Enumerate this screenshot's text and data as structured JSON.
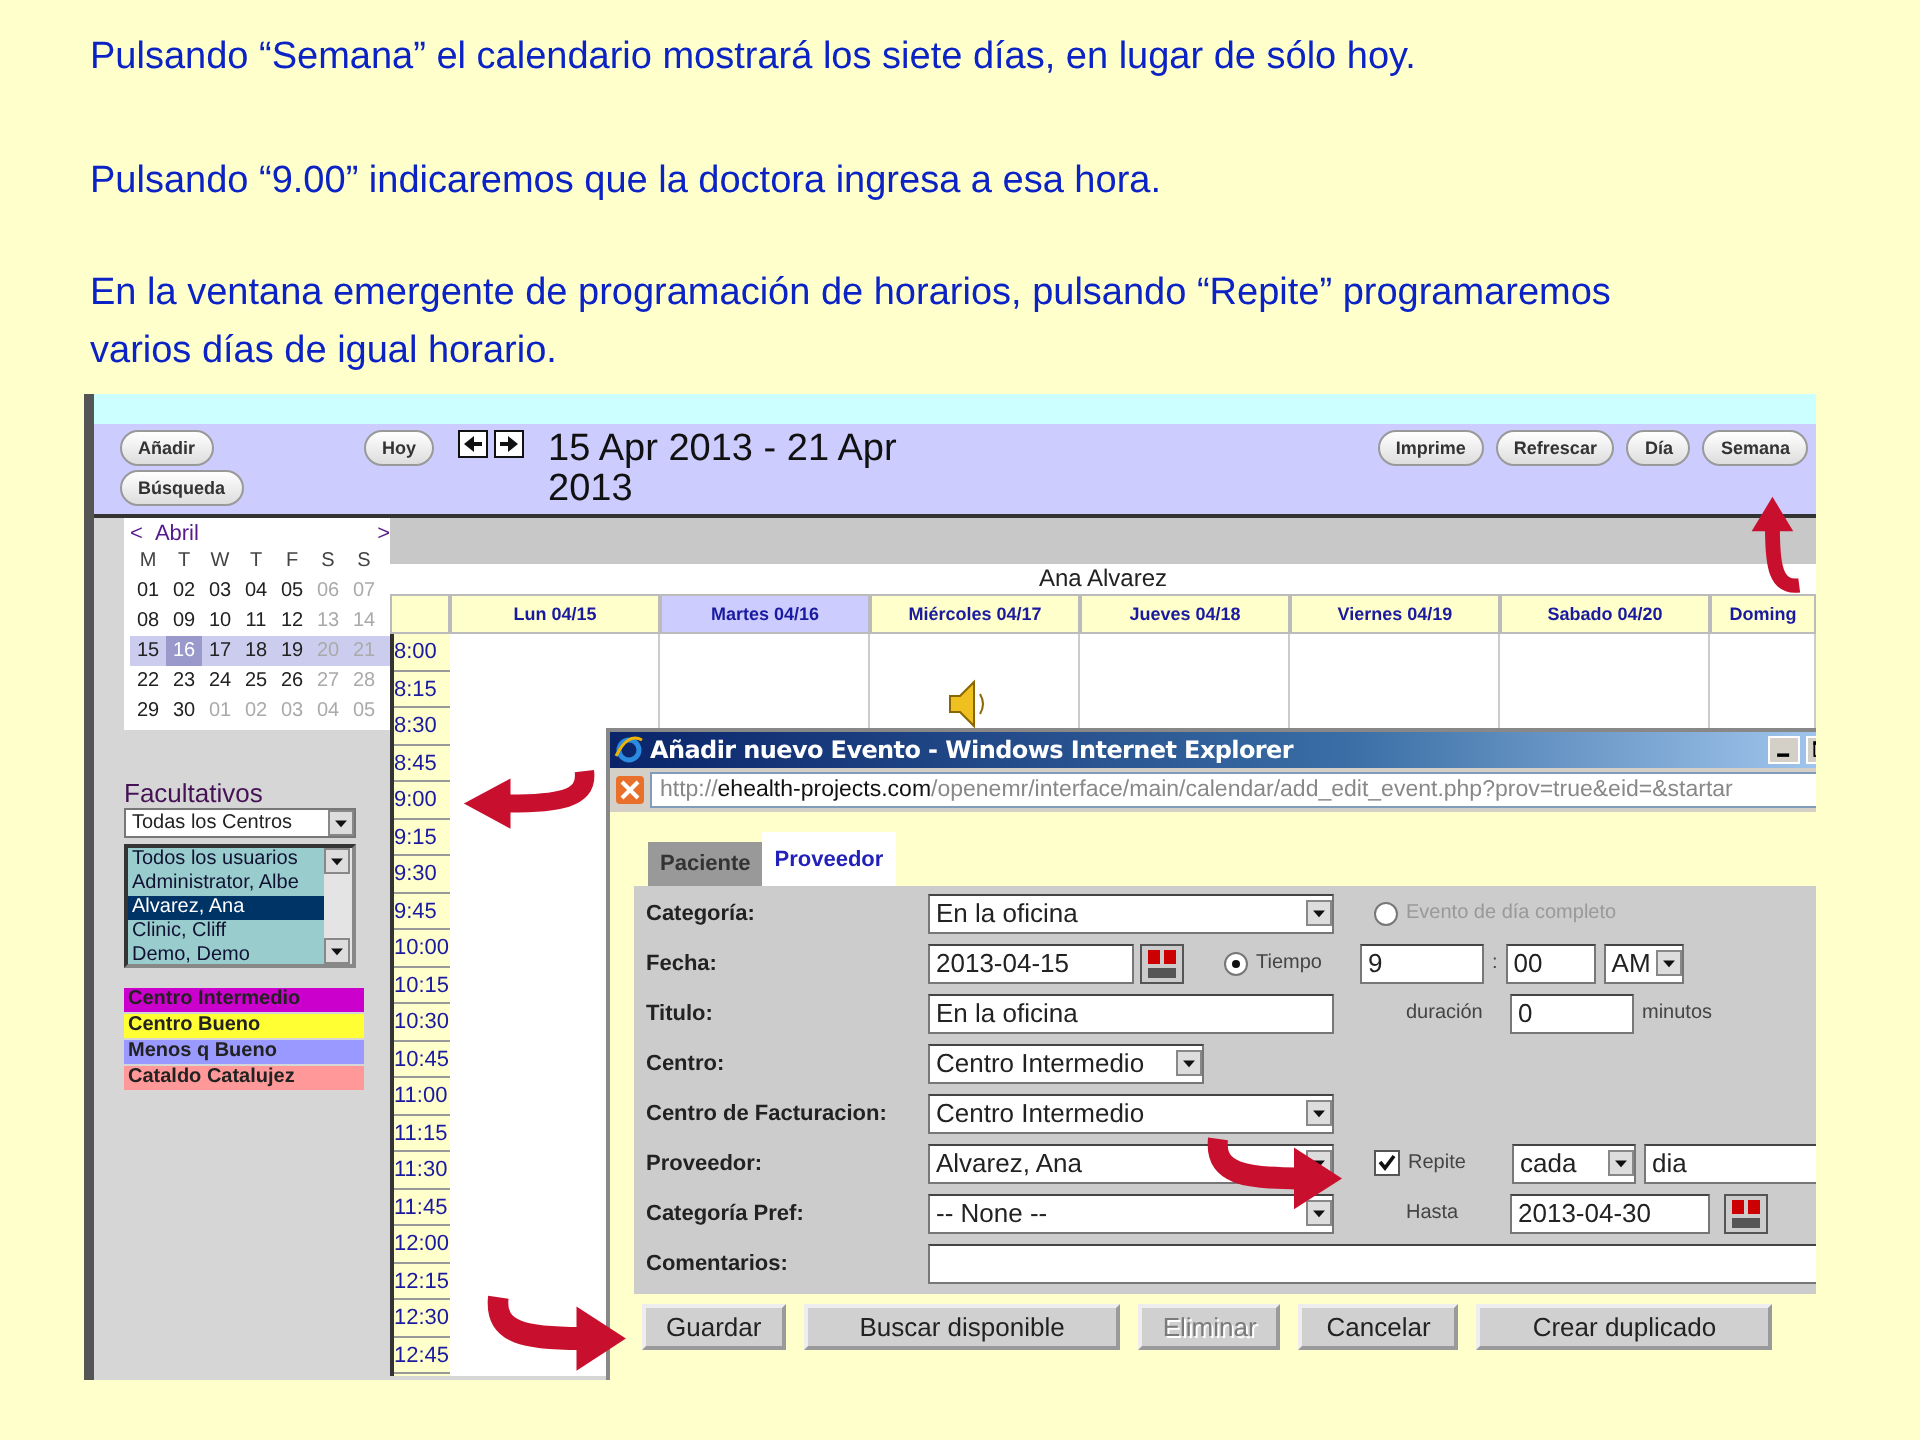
{
  "instructions": [
    "Pulsando “Semana” el calendario mostrará los siete días, en lugar de sólo hoy.",
    "Pulsando “9.00” indicaremos que la doctora ingresa a esa hora.",
    "En la ventana emergente de programación de horarios, pulsando “Repite” programaremos varios días de igual horario."
  ],
  "calendar_app": {
    "toolbar": {
      "left_buttons": [
        "Añadir",
        "Búsqueda"
      ],
      "today_button": "Hoy",
      "date_range": "15 Apr 2013 - 21 Apr 2013",
      "view_buttons": [
        "Imprime",
        "Refrescar",
        "Día",
        "Semana"
      ]
    },
    "mini_calendar": {
      "prev": "<",
      "month": "Abril",
      "next": ">",
      "weekdays": [
        "M",
        "T",
        "W",
        "T",
        "F",
        "S",
        "S"
      ],
      "weeks": [
        {
          "selected": false,
          "days": [
            {
              "label": "01",
              "muted": false,
              "current": false
            },
            {
              "label": "02",
              "muted": false,
              "current": false
            },
            {
              "label": "03",
              "muted": false,
              "current": false
            },
            {
              "label": "04",
              "muted": false,
              "current": false
            },
            {
              "label": "05",
              "muted": false,
              "current": false
            },
            {
              "label": "06",
              "muted": true,
              "current": false
            },
            {
              "label": "07",
              "muted": true,
              "current": false
            }
          ]
        },
        {
          "selected": false,
          "days": [
            {
              "label": "08",
              "muted": false,
              "current": false
            },
            {
              "label": "09",
              "muted": false,
              "current": false
            },
            {
              "label": "10",
              "muted": false,
              "current": false
            },
            {
              "label": "11",
              "muted": false,
              "current": false
            },
            {
              "label": "12",
              "muted": false,
              "current": false
            },
            {
              "label": "13",
              "muted": true,
              "current": false
            },
            {
              "label": "14",
              "muted": true,
              "current": false
            }
          ]
        },
        {
          "selected": true,
          "days": [
            {
              "label": "15",
              "muted": false,
              "current": false
            },
            {
              "label": "16",
              "muted": false,
              "current": true
            },
            {
              "label": "17",
              "muted": false,
              "current": false
            },
            {
              "label": "18",
              "muted": false,
              "current": false
            },
            {
              "label": "19",
              "muted": false,
              "current": false
            },
            {
              "label": "20",
              "muted": true,
              "current": false
            },
            {
              "label": "21",
              "muted": true,
              "current": false
            }
          ]
        },
        {
          "selected": false,
          "days": [
            {
              "label": "22",
              "muted": false,
              "current": false
            },
            {
              "label": "23",
              "muted": false,
              "current": false
            },
            {
              "label": "24",
              "muted": false,
              "current": false
            },
            {
              "label": "25",
              "muted": false,
              "current": false
            },
            {
              "label": "26",
              "muted": false,
              "current": false
            },
            {
              "label": "27",
              "muted": true,
              "current": false
            },
            {
              "label": "28",
              "muted": true,
              "current": false
            }
          ]
        },
        {
          "selected": false,
          "days": [
            {
              "label": "29",
              "muted": false,
              "current": false
            },
            {
              "label": "30",
              "muted": false,
              "current": false
            },
            {
              "label": "01",
              "muted": true,
              "current": false
            },
            {
              "label": "02",
              "muted": true,
              "current": false
            },
            {
              "label": "03",
              "muted": true,
              "current": false
            },
            {
              "label": "04",
              "muted": true,
              "current": false
            },
            {
              "label": "05",
              "muted": true,
              "current": false
            }
          ]
        }
      ]
    },
    "providers": {
      "title": "Facultativos",
      "facility_select": "Todas los Centros",
      "list": [
        {
          "label": "Todos los usuarios",
          "selected": false
        },
        {
          "label": "Administrator, Albe",
          "selected": false
        },
        {
          "label": "Alvarez, Ana",
          "selected": true
        },
        {
          "label": "Clinic, Cliff",
          "selected": false
        },
        {
          "label": "Demo, Demo",
          "selected": false
        }
      ]
    },
    "facility_legend": [
      {
        "label": "Centro Intermedio",
        "color": "#cc00cc"
      },
      {
        "label": "Centro Bueno",
        "color": "#ffff33"
      },
      {
        "label": "Menos q Bueno",
        "color": "#9999ff"
      },
      {
        "label": "Cataldo Catalujez",
        "color": "#ff9999"
      }
    ],
    "schedule": {
      "provider_name": "Ana Alvarez",
      "days": [
        {
          "label": "Lun 04/15",
          "selected": false
        },
        {
          "label": "Martes 04/16",
          "selected": true
        },
        {
          "label": "Miércoles 04/17",
          "selected": false
        },
        {
          "label": "Jueves 04/18",
          "selected": false
        },
        {
          "label": "Viernes 04/19",
          "selected": false
        },
        {
          "label": "Sabado 04/20",
          "selected": false
        },
        {
          "label": "Doming",
          "selected": false
        }
      ],
      "times": [
        "8:00",
        "8:15",
        "8:30",
        "8:45",
        "9:00",
        "9:15",
        "9:30",
        "9:45",
        "10:00",
        "10:15",
        "10:30",
        "10:45",
        "11:00",
        "11:15",
        "11:30",
        "11:45",
        "12:00",
        "12:15",
        "12:30",
        "12:45"
      ]
    }
  },
  "dialog": {
    "title": "Añadir nuevo Evento - Windows Internet Explorer",
    "url": {
      "scheme": "http://",
      "host": "ehealth-projects.com",
      "path": "/openemr/interface/main/calendar/add_edit_event.php?prov=true&eid=&startar"
    },
    "tabs": [
      {
        "label": "Paciente",
        "selected": false
      },
      {
        "label": "Proveedor",
        "selected": true
      }
    ],
    "rows": [
      {
        "label": "Categoría:",
        "field": {
          "kind": "select",
          "value": "En la oficina"
        },
        "side": {
          "kind": "radio",
          "label": "Evento de día completo",
          "selected": false
        }
      },
      {
        "label": "Fecha:",
        "field": {
          "kind": "date",
          "value": "2013-04-15"
        },
        "side": {
          "kind": "time",
          "label": "Tiempo",
          "selected": true,
          "hour": "9",
          "separator": ":",
          "minute": "00",
          "period": "AM"
        }
      },
      {
        "label": "Titulo:",
        "field": {
          "kind": "input",
          "value": "En la oficina"
        },
        "side": {
          "kind": "duration",
          "label": "duración",
          "value": "0",
          "unit": "minutos"
        }
      },
      {
        "label": "Centro:",
        "field": {
          "kind": "select",
          "value": "Centro Intermedio"
        }
      },
      {
        "label": "Centro de Facturacion:",
        "field": {
          "kind": "select",
          "value": "Centro Intermedio"
        }
      },
      {
        "label": "Proveedor:",
        "field": {
          "kind": "select",
          "value": "Alvarez, Ana"
        },
        "side": {
          "kind": "repeat",
          "label": "Repite",
          "checked": true,
          "every": "cada",
          "unit": "dia"
        }
      },
      {
        "label": "Categoría Pref:",
        "field": {
          "kind": "select",
          "value": "-- None --"
        },
        "side": {
          "kind": "until",
          "label": "Hasta",
          "value": "2013-04-30"
        }
      },
      {
        "label": "Comentarios:",
        "field": {
          "kind": "wide_input"
        }
      }
    ],
    "buttons": [
      {
        "label": "Guardar",
        "disabled": false
      },
      {
        "label": "Buscar disponible",
        "disabled": false
      },
      {
        "label": "Eliminar",
        "disabled": true
      },
      {
        "label": "Cancelar",
        "disabled": false
      },
      {
        "label": "Crear duplicado",
        "disabled": false
      }
    ]
  }
}
